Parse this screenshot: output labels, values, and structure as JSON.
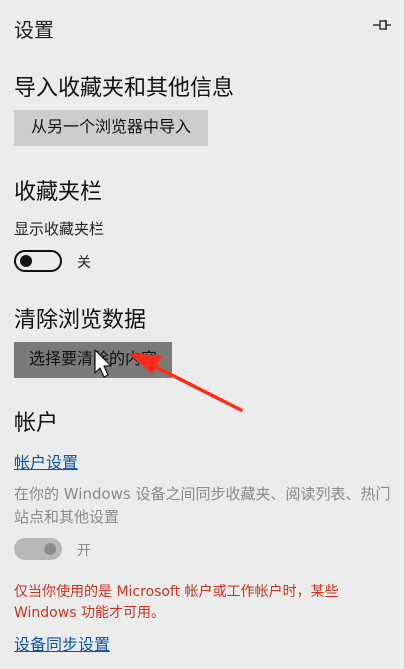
{
  "panel": {
    "title": "设置"
  },
  "import_section": {
    "heading": "导入收藏夹和其他信息",
    "button": "从另一个浏览器中导入"
  },
  "favorites_bar": {
    "heading": "收藏夹栏",
    "label": "显示收藏夹栏",
    "toggle_state": "关"
  },
  "clear_data": {
    "heading": "清除浏览数据",
    "button": "选择要清除的内容"
  },
  "account": {
    "heading": "帐户",
    "settings_link": "帐户设置",
    "sync_description": "在你的 Windows 设备之间同步收藏夹、阅读列表、热门站点和其他设置",
    "sync_toggle_state": "开",
    "warning": "仅当你使用的是 Microsoft 帐户或工作帐户时，某些 Windows 功能才可用。",
    "sync_settings_link": "设备同步设置"
  },
  "colors": {
    "link": "#0a52a8",
    "warning": "#c8321d",
    "annotation_arrow": "#ff2a1a"
  }
}
